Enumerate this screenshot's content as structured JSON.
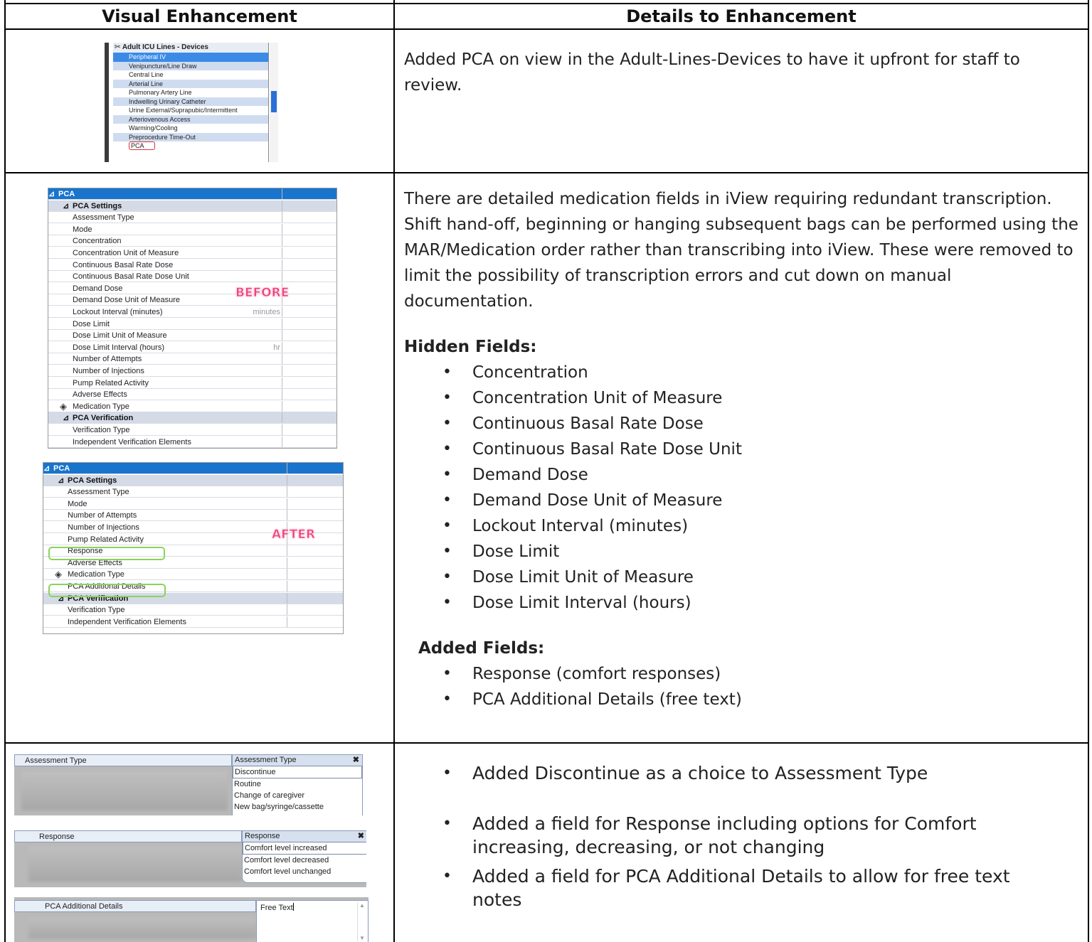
{
  "table": {
    "headers": [
      "Visual Enhancement",
      "Details to Enhancement"
    ]
  },
  "row1": {
    "text": "Added PCA on view in the Adult-Lines-Devices to have it upfront for staff to review.",
    "shot": {
      "title": "Adult ICU Lines - Devices",
      "items": [
        "Peripheral IV",
        "Venipuncture/Line Draw",
        "Central Line",
        "Arterial Line",
        "Pulmonary Artery Line",
        "Indwelling Urinary Catheter",
        "Urine External/Suprapubic/Intermittent",
        "Arteriovenous Access",
        "Warming/Cooling",
        "Preprocedure Time-Out",
        "PCA"
      ]
    }
  },
  "row2": {
    "paragraph": "There are detailed medication fields in iView requiring redundant transcription. Shift hand-off, beginning or hanging subsequent bags can be performed using the MAR/Medication order rather than transcribing into iView. These were removed to limit the possibility of transcription errors and cut down on manual documentation.",
    "hidden_heading": "Hidden Fields:",
    "hidden_fields": [
      "Concentration",
      "Concentration Unit of Measure",
      "Continuous Basal Rate Dose",
      "Continuous Basal Rate Dose Unit",
      "Demand Dose",
      "Demand Dose Unit of Measure",
      "Lockout Interval (minutes)",
      "Dose Limit",
      "Dose Limit Unit of Measure",
      "Dose Limit Interval (hours)"
    ],
    "added_heading": "Added Fields:",
    "added_fields": [
      "Response (comfort responses)",
      "PCA Additional Details (free text)"
    ],
    "before": {
      "label": "BEFORE",
      "head": "PCA",
      "settings": "PCA Settings",
      "rows": [
        "Assessment Type",
        "Mode",
        "Concentration",
        "Concentration Unit of Measure",
        "Continuous Basal Rate Dose",
        "Continuous Basal Rate Dose Unit",
        "Demand Dose",
        "Demand Dose Unit of Measure",
        "Lockout Interval (minutes)",
        "Dose Limit",
        "Dose Limit Unit of Measure",
        "Dose Limit Interval (hours)",
        "Number of Attempts",
        "Number of Injections",
        "Pump Related Activity",
        "Adverse Effects",
        "Medication Type"
      ],
      "unit_minutes": "minutes",
      "unit_hr": "hr",
      "verification": "PCA Verification",
      "ver_rows": [
        "Verification Type",
        "Independent Verification Elements"
      ]
    },
    "after": {
      "label": "AFTER",
      "head": "PCA",
      "settings": "PCA Settings",
      "rows": [
        "Assessment Type",
        "Mode",
        "Number of Attempts",
        "Number of Injections",
        "Pump Related Activity",
        "Response",
        "Adverse Effects",
        "Medication Type",
        "PCA Additional Details"
      ],
      "verification": "PCA Verification",
      "ver_rows": [
        "Verification Type",
        "Independent Verification Elements"
      ]
    }
  },
  "row3": {
    "bullets": [
      "Added Discontinue as a choice to Assessment Type",
      "Added a field for Response including options for Comfort increasing, decreasing, or not changing",
      "Added a field for PCA Additional Details to allow for free text notes"
    ],
    "assess": {
      "label": "Assessment Type",
      "panel_title": "Assessment Type",
      "options": [
        "Discontinue",
        "Routine",
        "Change of caregiver",
        "New bag/syringe/cassette"
      ]
    },
    "response": {
      "label": "Response",
      "panel_title": "Response",
      "options": [
        "Comfort level increased",
        "Comfort level decreased",
        "Comfort level unchanged"
      ]
    },
    "details": {
      "label": "PCA Additional Details",
      "value": "Free Text"
    },
    "close_glyph": "✖"
  }
}
